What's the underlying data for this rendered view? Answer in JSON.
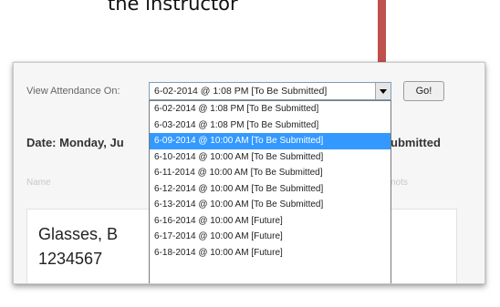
{
  "caption": "the instructor",
  "toolbar": {
    "view_label": "View Attendance On:",
    "selected_value": "6-02-2014 @ 1:08 PM [To Be Submitted]",
    "go_label": "Go!"
  },
  "date_header": {
    "left": "Date: Monday, Ju",
    "right": "ubmitted"
  },
  "columns": {
    "name": "Name",
    "right": "nots"
  },
  "student": {
    "name": "Glasses, B",
    "id": "1234567"
  },
  "dropdown": {
    "highlighted_index": 2,
    "options": [
      "6-02-2014 @ 1:08 PM [To Be Submitted]",
      "6-03-2014 @ 1:08 PM [To Be Submitted]",
      "6-09-2014 @ 10:00 AM [To Be Submitted]",
      "6-10-2014 @ 10:00 AM [To Be Submitted]",
      "6-11-2014 @ 10:00 AM [To Be Submitted]",
      "6-12-2014 @ 10:00 AM [To Be Submitted]",
      "6-13-2014 @ 10:00 AM [To Be Submitted]",
      "6-16-2014 @ 10:00 AM [Future]",
      "6-17-2014 @ 10:00 AM [Future]",
      "6-18-2014 @ 10:00 AM [Future]"
    ]
  },
  "colors": {
    "arrow": "#c0504d",
    "highlight": "#3399ff",
    "select_border": "#7f9db9"
  }
}
